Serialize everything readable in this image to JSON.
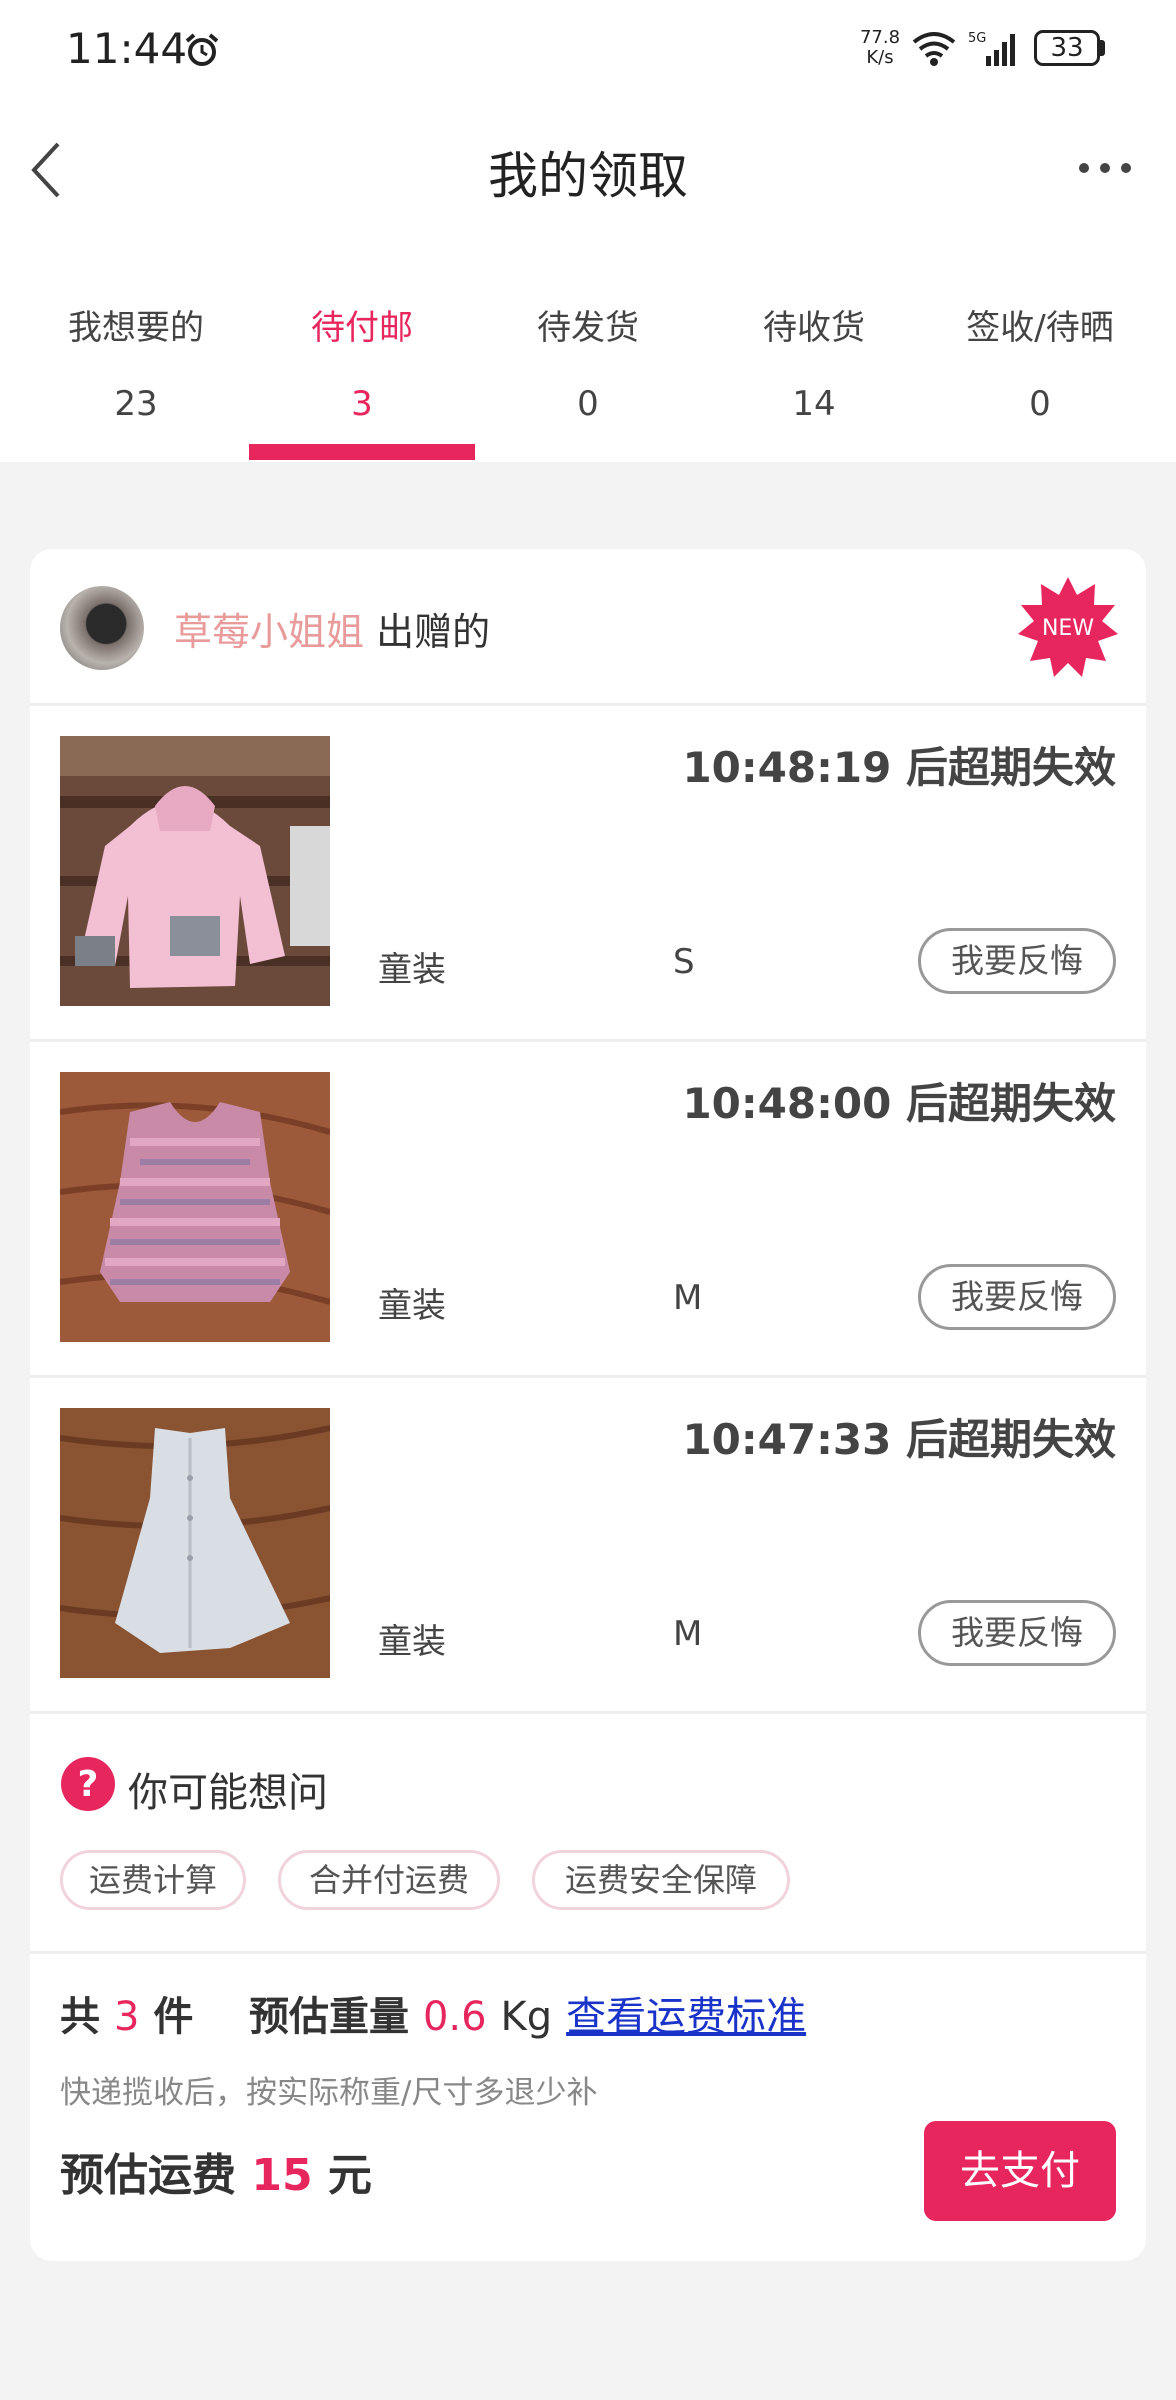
{
  "status_bar": {
    "time": "11:44",
    "speed_value": "77.8",
    "speed_unit": "K/s",
    "network": "5G",
    "battery": "33"
  },
  "header": {
    "title": "我的领取"
  },
  "tabs": [
    {
      "label": "我想要的",
      "count": "23"
    },
    {
      "label": "待付邮",
      "count": "3"
    },
    {
      "label": "待发货",
      "count": "0"
    },
    {
      "label": "待收货",
      "count": "14"
    },
    {
      "label": "签收/待晒",
      "count": "0"
    }
  ],
  "active_tab_index": 1,
  "colors": {
    "accent": "#e8265e",
    "giver_name": "#e99a9a",
    "link": "#1a33c8"
  },
  "card": {
    "giver_name": "草莓小姐姐",
    "giver_suffix": "出赠的",
    "badge": "NEW",
    "items": [
      {
        "deadline": "10:48:19 后超期失效",
        "category": "童装",
        "size": "S",
        "action": "我要反悔",
        "photo": "pink-jacket"
      },
      {
        "deadline": "10:48:00 后超期失效",
        "category": "童装",
        "size": "M",
        "action": "我要反悔",
        "photo": "knit-vest"
      },
      {
        "deadline": "10:47:33 后超期失效",
        "category": "童装",
        "size": "M",
        "action": "我要反悔",
        "photo": "white-dress"
      }
    ]
  },
  "faq": {
    "title": "你可能想问",
    "chips": [
      "运费计算",
      "合并付运费",
      "运费安全保障"
    ]
  },
  "summary": {
    "total_prefix": "共",
    "total_count": "3",
    "total_suffix": "件",
    "weight_label": "预估重量",
    "weight_value": "0.6",
    "weight_unit": "Kg",
    "link": "查看运费标准",
    "note": "快递揽收后，按实际称重/尺寸多退少补",
    "fee_label": "预估运费",
    "fee_value": "15",
    "fee_unit": "元",
    "pay_button": "去支付"
  }
}
